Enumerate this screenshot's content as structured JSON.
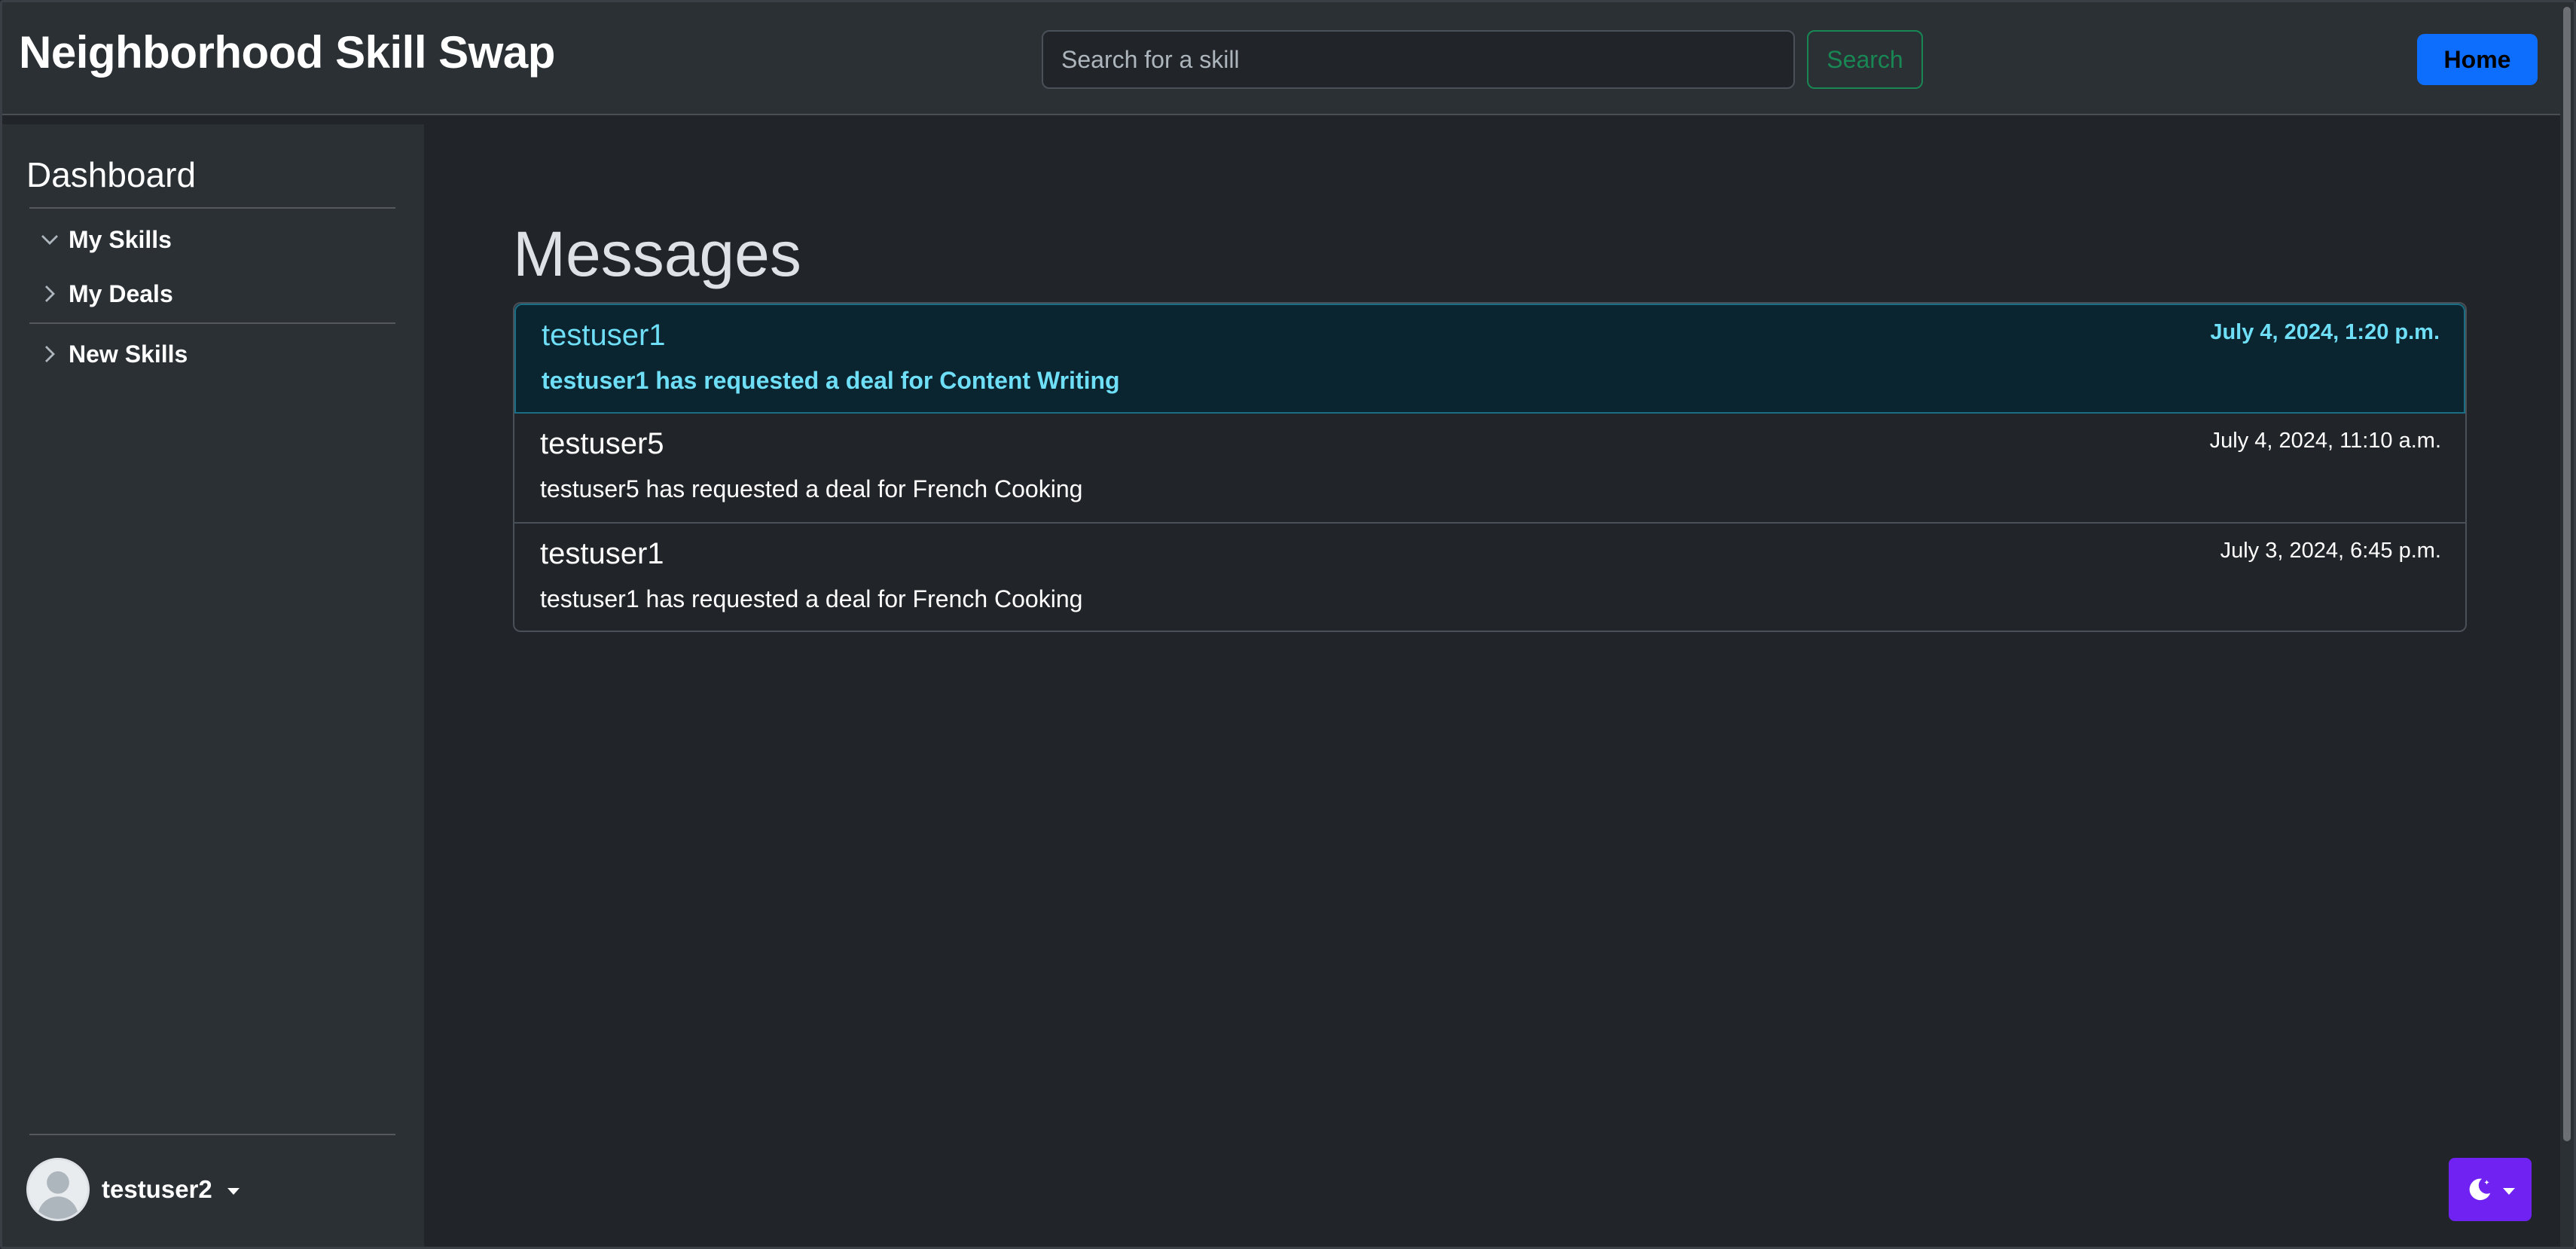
{
  "header": {
    "brand": "Neighborhood Skill Swap",
    "search_placeholder": "Search for a skill",
    "search_label": "Search",
    "home_label": "Home"
  },
  "sidebar": {
    "title": "Dashboard",
    "items": [
      {
        "label": "My Skills",
        "icon": "chevron-down-icon"
      },
      {
        "label": "My Deals",
        "icon": "chevron-right-icon"
      },
      {
        "label": "New Skills",
        "icon": "chevron-right-icon"
      }
    ],
    "user": {
      "name": "testuser2"
    }
  },
  "main": {
    "title": "Messages",
    "messages": [
      {
        "sender": "testuser1",
        "time": "July 4, 2024, 1:20 p.m.",
        "body": "testuser1 has requested a deal for Content Writing",
        "active": true
      },
      {
        "sender": "testuser5",
        "time": "July 4, 2024, 11:10 a.m.",
        "body": "testuser5 has requested a deal for French Cooking",
        "active": false
      },
      {
        "sender": "testuser1",
        "time": "July 3, 2024, 6:45 p.m.",
        "body": "testuser1 has requested a deal for French Cooking",
        "active": false
      }
    ]
  },
  "colors": {
    "background": "#212529",
    "panel": "#2b3035",
    "primary": "#0d6efd",
    "success": "#198754",
    "info_text": "#6edff6",
    "theme_toggle": "#6f22f2"
  }
}
